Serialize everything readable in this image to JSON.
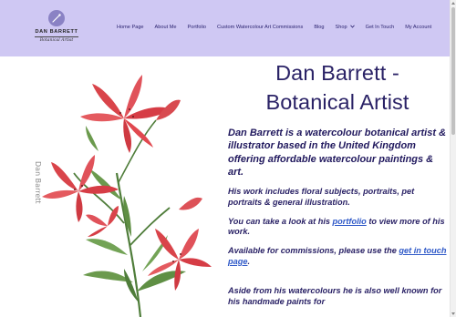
{
  "logo": {
    "name": "DAN BARRETT",
    "tagline": "Botanical Artist"
  },
  "nav": {
    "items": [
      {
        "label": "Home Page"
      },
      {
        "label": "About Me"
      },
      {
        "label": "Portfolio"
      },
      {
        "label": "Custom Watercolour Art Commissions"
      },
      {
        "label": "Blog"
      },
      {
        "label": "Shop"
      },
      {
        "label": "Get In Touch"
      },
      {
        "label": "My Account"
      }
    ]
  },
  "hero": {
    "signature": "Dan Barrett"
  },
  "main": {
    "title_line1": "Dan Barrett -",
    "title_line2": "Botanical Artist",
    "lead": "Dan Barrett is a watercolour botanical artist & illustrator based in the United Kingdom offering affordable watercolour paintings & art.",
    "p1": "His work includes floral subjects, portraits, pet portraits & general illustration.",
    "p2_before": "You can take a look at his ",
    "p2_link": "portfolio",
    "p2_after": " to view more of his work.",
    "p3_before": "Available for commissions, please use the ",
    "p3_link": "get in touch page",
    "p3_after": ".",
    "p4": "Aside from his watercolours he is also well known for his handmade paints for"
  },
  "colors": {
    "header_bg": "#cfc8f3",
    "text_primary": "#2a2266",
    "link": "#2f59c8"
  }
}
